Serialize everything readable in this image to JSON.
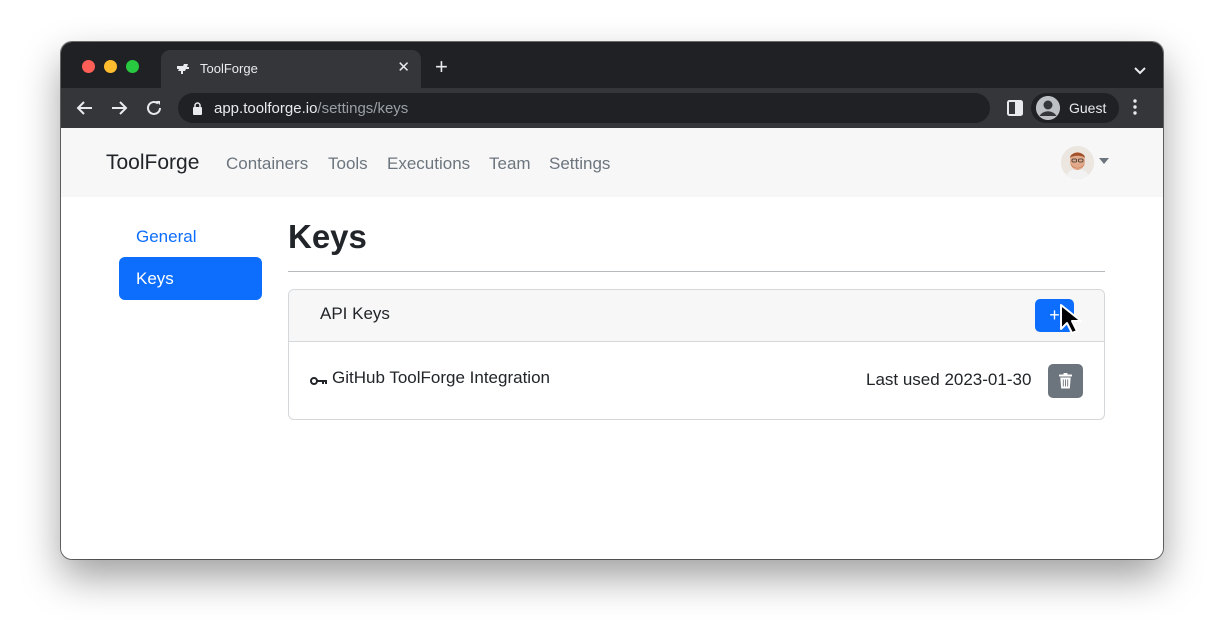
{
  "browser": {
    "tab": {
      "title": "ToolForge",
      "close_glyph": "✕"
    },
    "new_tab_glyph": "+",
    "address": {
      "domain": "app.toolforge.io",
      "path": "/settings/keys"
    },
    "profile": {
      "label": "Guest"
    },
    "colors": {
      "chrome_dark": "#202124",
      "chrome_mid": "#35363a"
    }
  },
  "navbar": {
    "brand": "ToolForge",
    "links": [
      "Containers",
      "Tools",
      "Executions",
      "Team",
      "Settings"
    ]
  },
  "sidebar": {
    "items": [
      {
        "label": "General",
        "active": false
      },
      {
        "label": "Keys",
        "active": true
      }
    ]
  },
  "main": {
    "heading": "Keys",
    "card": {
      "title": "API Keys",
      "add_label": "+",
      "keys": [
        {
          "icon": "key-icon",
          "name": "GitHub ToolForge Integration",
          "last_used": "Last used 2023-01-30"
        }
      ]
    }
  },
  "colors": {
    "primary": "#0d6efd",
    "secondary": "#6c757d",
    "navbar_bg": "#f7f7f8"
  }
}
